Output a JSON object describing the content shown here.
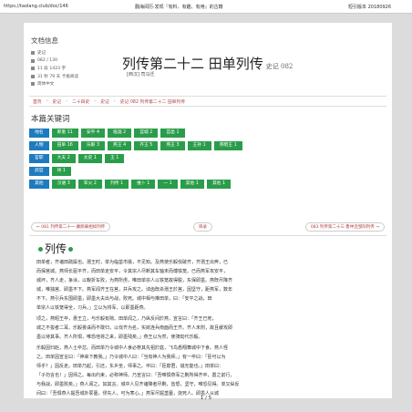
{
  "browser": {
    "url": "https://taolang.club/doc/146",
    "center": "翻海阅历·发现『有料、有趣、有用』的古籍",
    "right": "短引版本 20180926"
  },
  "info": {
    "heading": "文档信息",
    "rows": [
      {
        "icon": "book-icon",
        "text": "史记"
      },
      {
        "icon": "list-icon",
        "text": "082 / 130"
      },
      {
        "icon": "text-icon",
        "text": "11 段 1423 字"
      },
      {
        "icon": "clock-icon",
        "text": "31 秒 79 天 卡板阅读"
      },
      {
        "icon": "lang-icon",
        "text": "简体中文"
      }
    ]
  },
  "title": {
    "main": "列传第二十二  田单列传",
    "sub": "史记 082"
  },
  "author": "[西汉] 司马迁",
  "breadcrumb": [
    "首页",
    "史记",
    "二十四史",
    "史记",
    "史记 082 列传第二十二  田单列传"
  ],
  "keywords": {
    "heading": "本篇关键词",
    "rows": [
      {
        "cat": "地名",
        "words": [
          "即墨 11",
          "安平 4",
          "临淄 2",
          "莒城 2",
          "莒邑 1"
        ]
      },
      {
        "cat": "人物",
        "words": [
          "田单 16",
          "乐毅 3",
          "燕王 4",
          "齐王 5",
          "燕王 3",
          "王孙 1",
          "燕昭王 1"
        ]
      },
      {
        "cat": "官职",
        "words": [
          "大夫 2",
          "太史 1",
          "王 1"
        ]
      },
      {
        "cat": "武官",
        "words": [
          "将 1"
        ]
      },
      {
        "cat": "其他",
        "words": [
          "汉语 3",
          "军火 2",
          "列传 1",
          "维卜 1",
          "一 1",
          "其他 1",
          "其他 1"
        ]
      }
    ]
  },
  "pager": {
    "prev": "← 081 列传第二十一·廉颇蔺相如列传",
    "mid": "目录",
    "next": "083 列传第二十三·鲁仲连邹阳列传 →"
  },
  "section_title": "列传",
  "paragraphs": [
    {
      "lines": [
        "田单者，齐诸田疏属也。湣王时，单为临菑市掾，不见知。及燕使乐毅伐破齐，齐湣王出奔，已",
        "而保莒城。燕师长驱平齐，而田单走安平，令其宗人尽断其车轴末而傅铁笼。已而燕军攻安平，",
        "城坏，齐人走，争涂，以輗折车败，为燕所虏，唯田单宗人以铁笼故得脱，东保即墨。燕既尽降齐",
        "城，唯独莒、即墨不下。燕军闻齐王在莒，并兵攻之。淖齿既杀湣王於莒，因坚守，距燕军，数年",
        "不下。燕引兵东围即墨，即墨大夫出与战，败死。城中相与推田单，曰：「安平之战，田",
        "单宗人以铁笼得全，习兵。」立以为将军，以即墨距燕。"
      ]
    },
    {
      "lines": [
        "顷之，燕昭王卒，惠王立，与乐毅有隙。田单闻之，乃纵反间於燕，宣言曰：「齐王已死，",
        "城之不拔者二耳。乐毅畏诛而不敢归，以伐齐为名，实欲连兵南面而王齐。齐人未附，故且缓攻即",
        "墨以待其事。齐人所惧，唯恐他将之来，即墨残矣。」燕王以为然，使骑劫代乐毅。"
      ]
    },
    {
      "lines": [
        "乐毅因归赵，燕人士卒忿。而田单乃令城中人食必祭其先祖於庭，飞鸟悉翔舞城中下食。燕人怪",
        "之。田单因宣言曰：「神来下教我。」乃令城中人曰：「当有神人为我师。」有一卒曰：「臣可以为",
        "师乎？」因反走。田单乃起，引还，东乡坐，师事之。卒曰：「臣欺君，诚无能也。」田单曰：",
        "「子勿言也！」因师之。每出约束，必称神师。乃宣言曰：「吾唯惧燕军之劓所得齐卒，置之前行，",
        "与我战，即墨败矣。」燕人闻之，如其言。城中人见齐诸降者尽劓，皆怒，坚守，唯恐见得。单又纵反",
        "间曰：「吾惧燕人掘吾城外冢墓，僇先人，可为寒心。」燕军尽掘垄墓，烧死人。即墨人从城",
        "上望见，皆涕泣，俱欲出战，怒自十倍。"
      ]
    }
  ],
  "page_number": "1 / 5"
}
